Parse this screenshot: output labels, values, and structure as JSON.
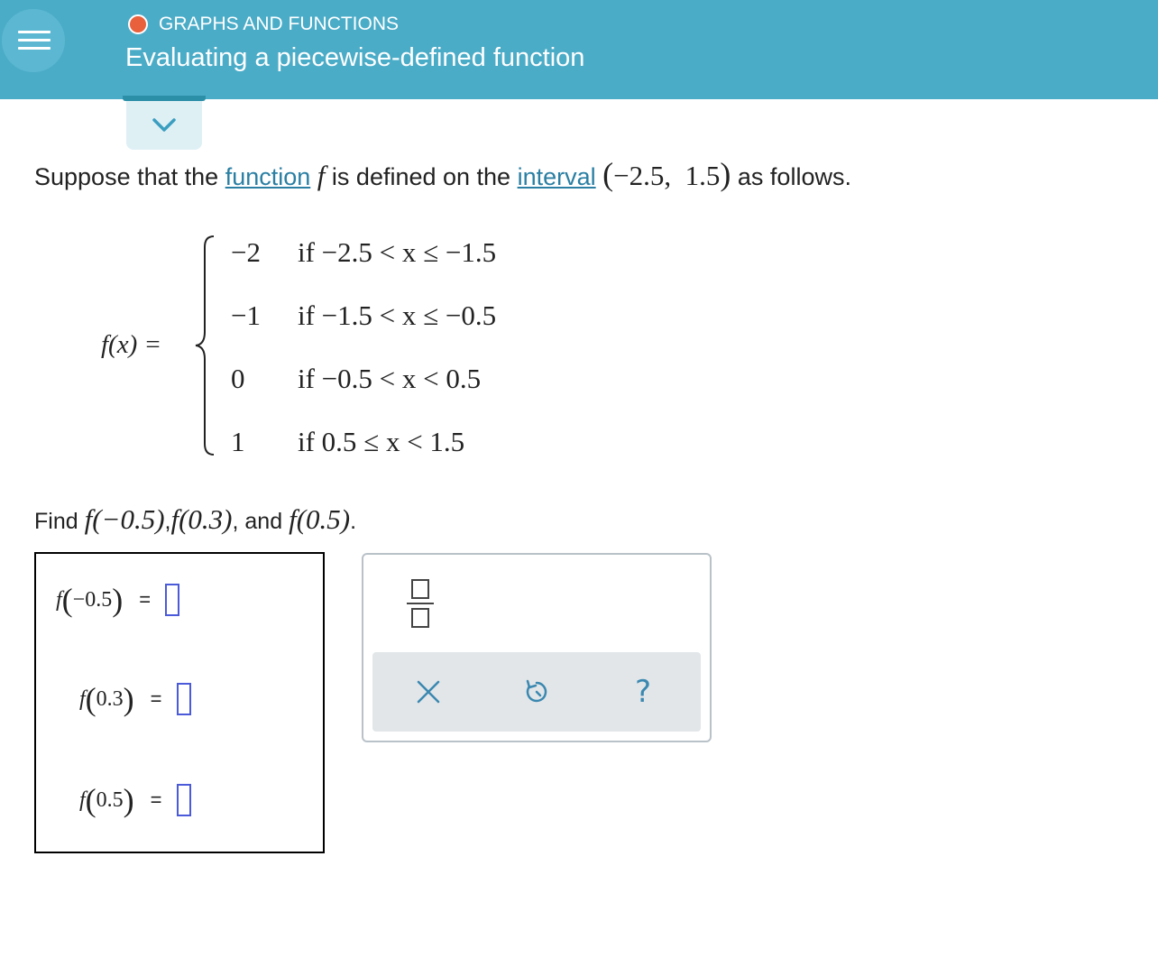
{
  "header": {
    "topic": "GRAPHS AND FUNCTIONS",
    "title": "Evaluating a piecewise-defined function",
    "topic_dot_color": "#e8603c",
    "bg_color": "#4bacc8"
  },
  "question": {
    "prompt_pre": "Suppose that the",
    "link_function": "function",
    "f": "f",
    "prompt_mid": "is defined on the",
    "link_interval": "interval",
    "interval_open": "(",
    "interval_values": "−2.5,  1.5",
    "interval_close": ")",
    "prompt_post": "as follows."
  },
  "piecewise": {
    "lhs": "f(x) =",
    "cases": [
      {
        "value": "−2",
        "condition": "if −2.5 < x ≤ −1.5"
      },
      {
        "value": "−1",
        "condition": "if −1.5 < x ≤ −0.5"
      },
      {
        "value": "0",
        "condition": "if −0.5 < x < 0.5"
      },
      {
        "value": "1",
        "condition": "if 0.5 ≤ x < 1.5"
      }
    ]
  },
  "find": {
    "label": "Find",
    "expr1": "f(−0.5)",
    "comma1": ",",
    "expr2": "f(0.3)",
    "comma2": ",",
    "and": "and",
    "expr3": "f(0.5)",
    "period": "."
  },
  "answers": [
    {
      "f": "f",
      "open": "(",
      "arg": "−0.5",
      "close": ")",
      "eq": "=",
      "value": ""
    },
    {
      "f": "f",
      "open": "(",
      "arg": "0.3",
      "close": ")",
      "eq": "=",
      "value": ""
    },
    {
      "f": "f",
      "open": "(",
      "arg": "0.5",
      "close": ")",
      "eq": "=",
      "value": ""
    }
  ],
  "keypad": {
    "fraction_icon": "fraction-icon",
    "clear_icon": "x-icon",
    "undo_icon": "undo-icon",
    "help_label": "?",
    "accent_color": "#3b88b0"
  }
}
